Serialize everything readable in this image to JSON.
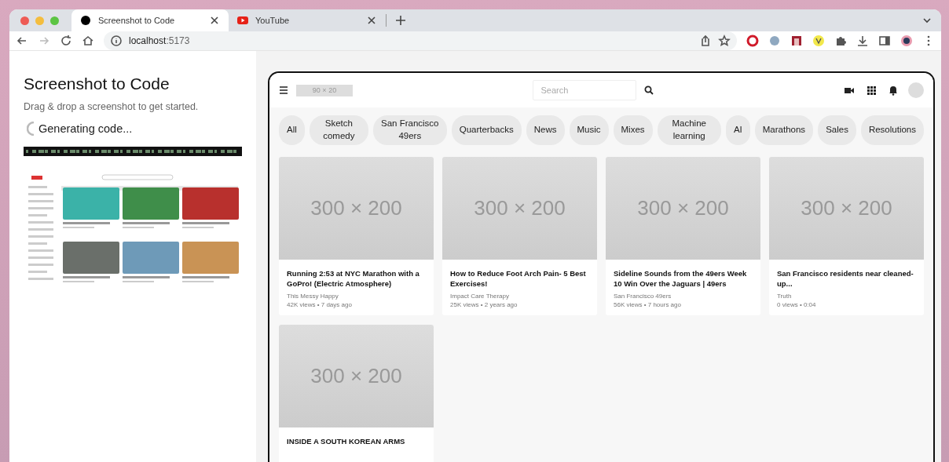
{
  "browser": {
    "tabs": [
      {
        "title": "Screenshot to Code",
        "selected": true,
        "kind": "dot"
      },
      {
        "title": "YouTube",
        "selected": false,
        "kind": "youtube"
      }
    ],
    "url_host": "localhost",
    "url_rest": ":5173"
  },
  "sidebar": {
    "title": "Screenshot to Code",
    "subtitle": "Drag & drop a screenshot to get started.",
    "status": "Generating code..."
  },
  "preview": {
    "logo_placeholder": "90 × 20",
    "search_placeholder": "Search",
    "chips": [
      "All",
      "Sketch comedy",
      "San Francisco 49ers",
      "Quarterbacks",
      "News",
      "Music",
      "Mixes",
      "Machine learning",
      "AI",
      "Marathons",
      "Sales",
      "Resolutions"
    ],
    "videos": [
      {
        "thumbnail_label": "300 × 200",
        "title": "Running 2:53 at NYC Marathon with a GoPro! (Electric Atmosphere)",
        "channel": "This Messy Happy",
        "meta": "42K views • 7 days ago"
      },
      {
        "thumbnail_label": "300 × 200",
        "title": "How to Reduce Foot Arch Pain- 5 Best Exercises!",
        "channel": "Impact Care Therapy",
        "meta": "25K views • 2 years ago"
      },
      {
        "thumbnail_label": "300 × 200",
        "title": "Sideline Sounds from the 49ers Week 10 Win Over the Jaguars | 49ers",
        "channel": "San Francisco 49ers",
        "meta": "56K views • 7 hours ago"
      },
      {
        "thumbnail_label": "300 × 200",
        "title": "San Francisco residents near cleaned-up...",
        "channel": "Truth",
        "meta": "0 views • 0:04"
      },
      {
        "thumbnail_label": "300 × 200",
        "title": "INSIDE A SOUTH KOREAN ARMS"
      }
    ]
  }
}
